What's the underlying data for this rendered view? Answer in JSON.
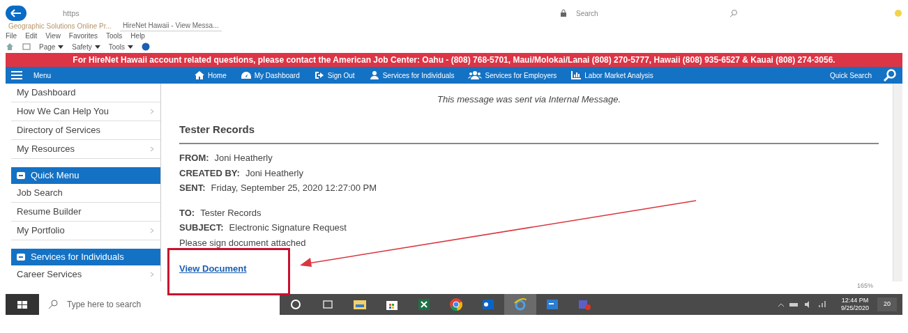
{
  "browser": {
    "url": "https",
    "search_placeholder": "Search",
    "tabs": [
      {
        "title": "Geographic Solutions Online Pr...",
        "selected": false
      },
      {
        "title": "HireNet Hawaii - View Messa...",
        "selected": true
      }
    ],
    "menu": [
      "File",
      "Edit",
      "View",
      "Favorites",
      "Tools",
      "Help"
    ],
    "toolbar": [
      "Page",
      "Safety",
      "Tools"
    ]
  },
  "banner": {
    "text": "For HireNet Hawaii account related questions, please contact the American Job Center: Oahu - (808) 768-5701, Maui/Molokai/Lanai (808) 270-5777, Hawaii (808) 935-6527 & Kauai (808) 274-3056."
  },
  "nav": {
    "menu_label": "Menu",
    "items": [
      {
        "label": "Home",
        "kind": "home"
      },
      {
        "label": "My Dashboard",
        "kind": "dashboard"
      },
      {
        "label": "Sign Out",
        "kind": "signout"
      },
      {
        "label": "Services for Individuals",
        "kind": "person"
      },
      {
        "label": "Services for Employers",
        "kind": "people"
      },
      {
        "label": "Labor Market Analysis",
        "kind": "chart"
      }
    ],
    "quick_search": "Quick Search"
  },
  "sidebar": {
    "groups": [
      {
        "items": [
          {
            "label": "My Dashboard",
            "submenu": false
          },
          {
            "label": "How We Can Help You",
            "submenu": true
          },
          {
            "label": "Directory of Services",
            "submenu": false
          },
          {
            "label": "My Resources",
            "submenu": true
          }
        ]
      },
      {
        "title": "Quick Menu",
        "items": [
          {
            "label": "Job Search",
            "submenu": false
          },
          {
            "label": "Resume Builder",
            "submenu": false
          },
          {
            "label": "My Portfolio",
            "submenu": true
          }
        ]
      },
      {
        "title": "Services for Individuals",
        "items": [
          {
            "label": "Career Services",
            "submenu": true
          }
        ]
      }
    ]
  },
  "message": {
    "note": "This message was sent via Internal Message.",
    "title": "Tester Records",
    "header_fields": [
      {
        "label": "FROM:",
        "value": "Joni Heatherly"
      },
      {
        "label": "CREATED BY:",
        "value": "Joni Heatherly"
      },
      {
        "label": "SENT:",
        "value": "Friday, September 25, 2020 12:27:00 PM"
      }
    ],
    "fields": [
      {
        "label": "TO:",
        "value": "Tester Records"
      },
      {
        "label": "SUBJECT:",
        "value": "Electronic Signature Request"
      }
    ],
    "body": "Please sign document attached",
    "link": "View Document"
  },
  "zoom": "165%",
  "taskbar": {
    "search_placeholder": "Type here to search",
    "apps": [
      {
        "kind": "taskview",
        "active": false
      },
      {
        "kind": "explorer",
        "active": false
      },
      {
        "kind": "files",
        "active": false
      },
      {
        "kind": "store",
        "active": false
      },
      {
        "kind": "excel",
        "active": false
      },
      {
        "kind": "chrome",
        "active": false
      },
      {
        "kind": "outlook",
        "active": false
      },
      {
        "kind": "ie",
        "active": true
      },
      {
        "kind": "word",
        "active": false
      },
      {
        "kind": "teams",
        "active": false
      }
    ],
    "time": "12:44 PM",
    "date": "9/25/2020",
    "notifications": "20"
  }
}
